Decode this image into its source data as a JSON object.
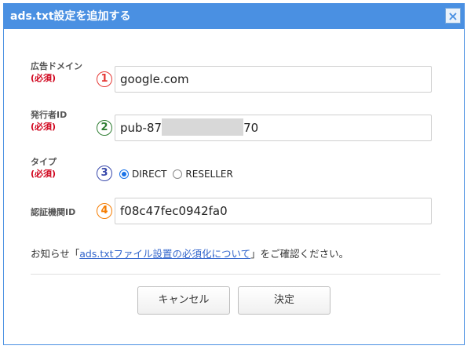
{
  "dialog": {
    "title": "ads.txt設定を追加する",
    "close_glyph": "×"
  },
  "fields": {
    "domain": {
      "label": "広告ドメイン",
      "required": "(必須)",
      "step": "1",
      "value": "google.com"
    },
    "publisher": {
      "label": "発行者ID",
      "required": "(必須)",
      "step": "2",
      "value_prefix": "pub-87",
      "value_suffix": "70"
    },
    "type": {
      "label": "タイプ",
      "required": "(必須)",
      "step": "3",
      "options": [
        {
          "label": "DIRECT",
          "checked": true
        },
        {
          "label": "RESELLER",
          "checked": false
        }
      ]
    },
    "cert": {
      "label": "認証機関ID",
      "step": "4",
      "value": "f08c47fec0942fa0"
    }
  },
  "notice": {
    "before": "お知らせ「",
    "link": "ads.txtファイル設置の必須化について",
    "after": "」をご確認ください。"
  },
  "buttons": {
    "cancel": "キャンセル",
    "confirm": "決定"
  },
  "colors": {
    "accent": "#4a90e2",
    "required": "#d0021b",
    "step1": "#e53935",
    "step2": "#2e7d32",
    "step3": "#3949ab",
    "step4": "#f57c00"
  }
}
